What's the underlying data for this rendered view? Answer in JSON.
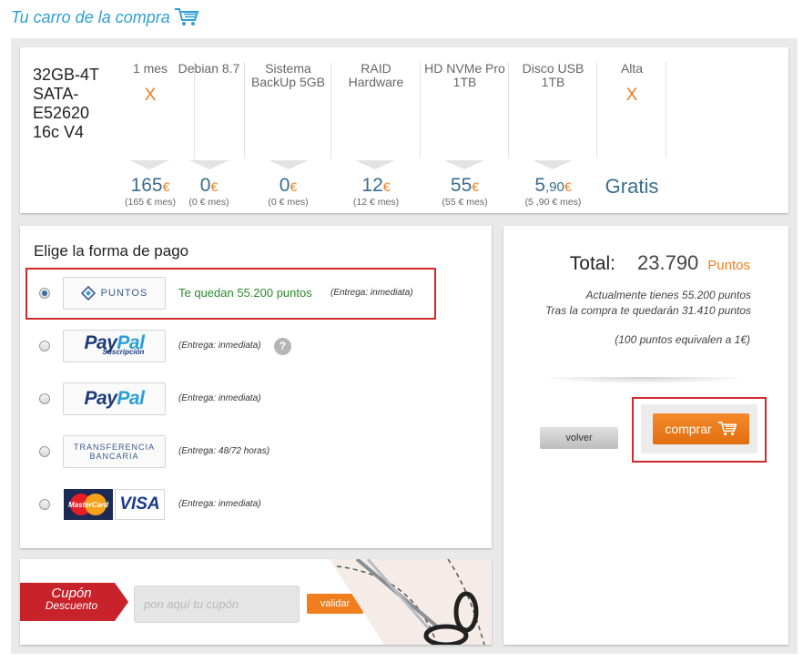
{
  "header": {
    "title": "Tu carro de la compra",
    "icon": "cart-icon",
    "color": "#2e9fd6"
  },
  "product": {
    "name": "32GB-4T SATA-E52620 16c V4",
    "columns": [
      {
        "head": "1 mes",
        "mark": "X",
        "price_int": "165",
        "price_dec": "",
        "currency": "€",
        "sub": "(165 € mes)"
      },
      {
        "head": "Debian 8.7",
        "mark": "",
        "price_int": "0",
        "price_dec": "",
        "currency": "€",
        "sub": "(0 € mes)"
      },
      {
        "head": "Sistema BackUp 5GB",
        "mark": "",
        "price_int": "0",
        "price_dec": "",
        "currency": "€",
        "sub": "(0 € mes)"
      },
      {
        "head": "RAID Hardware",
        "mark": "",
        "price_int": "12",
        "price_dec": "",
        "currency": "€",
        "sub": "(12 € mes)"
      },
      {
        "head": "HD NVMe Pro 1TB",
        "mark": "",
        "price_int": "55",
        "price_dec": "",
        "currency": "€",
        "sub": "(55 € mes)"
      },
      {
        "head": "Disco USB 1TB",
        "mark": "",
        "price_int": "5",
        "price_dec": ",90",
        "currency": "€",
        "sub": "(5 ,90 € mes)"
      },
      {
        "head": "Alta",
        "mark": "X",
        "gratis": "Gratis"
      }
    ]
  },
  "payment": {
    "title": "Elige la forma de pago",
    "methods": [
      {
        "logo": "PUNTOS",
        "icon": "points-icon",
        "remaining": "Te quedan 55.200 puntos",
        "delivery": "(Entrega: inmediata)",
        "selected": true
      },
      {
        "logo_a": "Pay",
        "logo_b": "Pal",
        "logo_sub": "Suscripción",
        "delivery": "(Entrega: inmediata)",
        "help": "?",
        "selected": false
      },
      {
        "logo_a": "Pay",
        "logo_b": "Pal",
        "delivery": "(Entrega: inmediata)",
        "selected": false
      },
      {
        "logo_line1": "TRANSFERENCIA",
        "logo_line2": "BANCARIA",
        "delivery": "(Entrega: 48/72 horas)",
        "selected": false
      },
      {
        "mc_label": "MasterCard",
        "visa_label": "VISA",
        "delivery": "(Entrega: inmediata)",
        "selected": false
      }
    ]
  },
  "coupon": {
    "title": "Cupón",
    "subtitle": "Descuento",
    "placeholder": "pon aquí tu cupón",
    "button": "validar"
  },
  "summary": {
    "total_label": "Total:",
    "total_value": "23.790",
    "total_unit": "Puntos",
    "info_line1": "Actualmente tienes 55.200 puntos",
    "info_line2": "Tras la compra te quedarán 31.410 puntos",
    "info_line3": "(100 puntos equivalen a 1€)",
    "back_button": "volver",
    "buy_button": "comprar"
  },
  "colors": {
    "accent": "#f07d1e",
    "brand_blue": "#2e9fd6",
    "highlight": "#d3282d",
    "green": "#2b8a2b"
  }
}
